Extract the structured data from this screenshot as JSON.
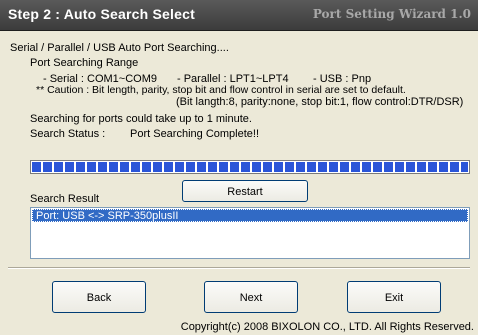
{
  "header": {
    "step_title": "Step 2 : Auto Search Select",
    "wizard_title": "Port Setting Wizard 1.0"
  },
  "content": {
    "heading": "Serial / Parallel / USB Auto Port Searching....",
    "range_label": "Port Searching Range",
    "range_serial": "- Serial : COM1~COM9",
    "range_parallel": "- Parallel : LPT1~LPT4",
    "range_usb": "- USB : Pnp",
    "caution_line1": "** Caution : Bit length, parity, stop bit and flow control in serial are set to default.",
    "caution_line2": "(Bit langth:8, parity:none, stop bit:1, flow control:DTR/DSR)",
    "time_note": "Searching for ports could take up to 1 minute.",
    "status_label": "Search Status :",
    "status_value": "Port Searching Complete!!",
    "progress": 1.0,
    "restart_label": "Restart",
    "result_label": "Search Result",
    "results": [
      "Port: USB <-> SRP-350plusII"
    ]
  },
  "footer": {
    "back_label": "Back",
    "next_label": "Next",
    "exit_label": "Exit",
    "copyright": "Copyright(c) 2008 BIXOLON CO., LTD. All Rights Reserved."
  },
  "colors": {
    "header_bg": "#4a4a4a",
    "progress_fill": "#2a55d8",
    "selection": "#316ac5",
    "window_bg": "#ece9d8"
  }
}
